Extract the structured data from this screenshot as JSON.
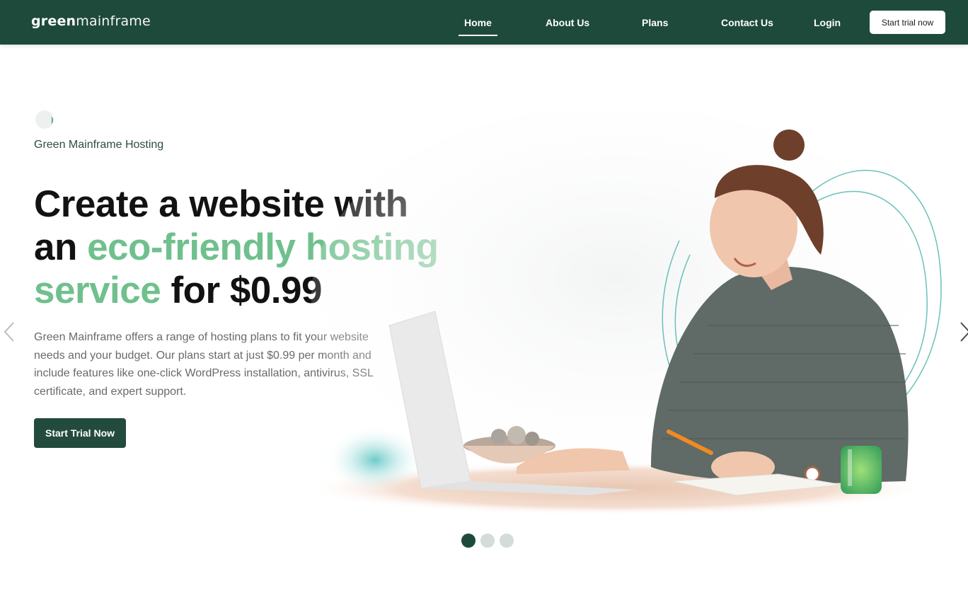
{
  "header": {
    "logo_bold": "green",
    "logo_light": "mainframe",
    "nav": [
      {
        "label": "Home",
        "active": true
      },
      {
        "label": "About Us",
        "active": false
      },
      {
        "label": "Plans",
        "active": false
      },
      {
        "label": "Contact Us",
        "active": false
      },
      {
        "label": "Login",
        "active": false
      }
    ],
    "cta_label": "Start trial now"
  },
  "hero": {
    "eyebrow": "Green Mainframe Hosting",
    "headline": {
      "part1": "Create a website with",
      "part2": "an ",
      "highlight1": "eco-friendly hosting",
      "highlight2": "service",
      "part3": " for $0.99"
    },
    "description": "Green Mainframe offers a range of hosting plans to fit your website needs and your budget. Our plans start at just $0.99 per month and include features like one-click WordPress installation, antivirus, SSL certificate, and expert support.",
    "cta_label": "Start Trial Now",
    "image_alt": "woman-using-laptop-photo"
  },
  "carousel": {
    "prev_icon": "chevron-left-icon",
    "next_icon": "chevron-right-icon",
    "slide_count": 3,
    "active_slide": 1
  },
  "colors": {
    "brand_dark": "#1e4a3c",
    "accent_green": "#6fc08d",
    "text_dark": "#121212",
    "text_muted": "#6a6a6a"
  }
}
